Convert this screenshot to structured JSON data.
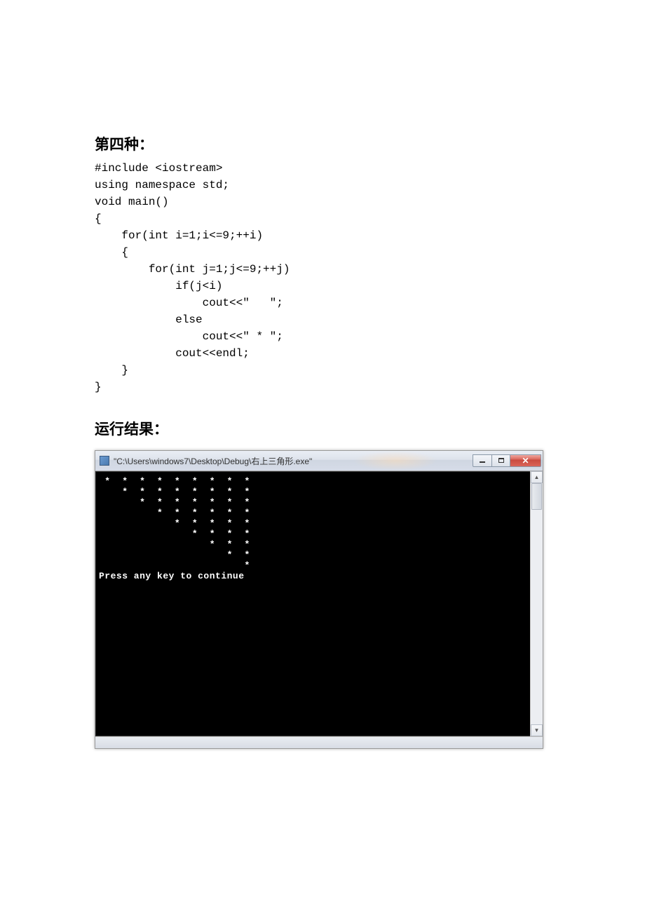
{
  "doc": {
    "heading1": "第四种：",
    "code": "#include <iostream>\nusing namespace std;\nvoid main()\n{\n    for(int i=1;i<=9;++i)\n    {\n        for(int j=1;j<=9;++j)\n            if(j<i)\n                cout<<\"   \";\n            else\n                cout<<\" * \";\n            cout<<endl;\n    }\n}",
    "heading2": "运行结果："
  },
  "window": {
    "title": "\"C:\\Users\\windows7\\Desktop\\Debug\\右上三角形.exe\"",
    "console_output": " *  *  *  *  *  *  *  *  *\n    *  *  *  *  *  *  *  *\n       *  *  *  *  *  *  *\n          *  *  *  *  *  *\n             *  *  *  *  *\n                *  *  *  *\n                   *  *  *\n                      *  *\n                         *\nPress any key to continue"
  }
}
